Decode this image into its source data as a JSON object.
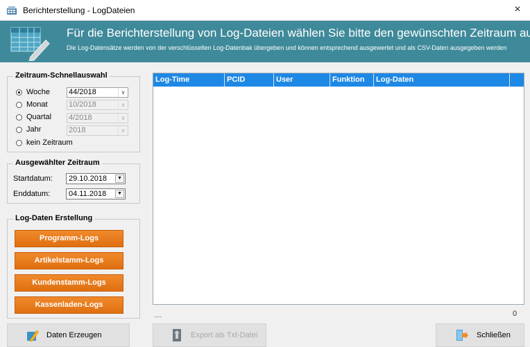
{
  "window": {
    "title": "Berichterstellung - LogDateien",
    "close": "×"
  },
  "banner": {
    "headline": "Für die Berichterstellung von Log-Dateien wählen Sie bitte den gewünschten Zeitraum aus.",
    "subline": "Die Log-Datensätze werden von der verschlüsselten Log-Datenbak übergeben und können entsprechend ausgewertet und als CSV-Daten ausgegeben werden",
    "color": "#3f8a9a"
  },
  "quick": {
    "title": "Zeitraum-Schnellauswahl",
    "options": [
      {
        "label": "Woche",
        "value": "44/2018",
        "checked": true,
        "enabled": true
      },
      {
        "label": "Monat",
        "value": "10/2018",
        "checked": false,
        "enabled": false
      },
      {
        "label": "Quartal",
        "value": "4/2018",
        "checked": false,
        "enabled": false
      },
      {
        "label": "Jahr",
        "value": "2018",
        "checked": false,
        "enabled": false
      },
      {
        "label": "kein Zeitraum",
        "value": null,
        "checked": false,
        "enabled": false
      }
    ]
  },
  "range": {
    "title": "Ausgewählter Zeitraum",
    "start_label": "Startdatum:",
    "start_value": "29.10.2018",
    "end_label": "Enddatum:",
    "end_value": "04.11.2018"
  },
  "logs": {
    "title": "Log-Daten Erstellung",
    "buttons": [
      "Programm-Logs",
      "Artikelstamm-Logs",
      "Kundenstamm-Logs",
      "Kassenladen-Logs"
    ],
    "color": "#e8781c"
  },
  "list": {
    "columns": [
      "Log-Time",
      "PCID",
      "User",
      "Funktion",
      "Log-Daten"
    ],
    "header_color": "#1e88e5",
    "status": "....",
    "count": "0"
  },
  "footer": {
    "generate": "Daten Erzeugen",
    "export": "Export als Txt-Datei",
    "close": "Schließen"
  }
}
